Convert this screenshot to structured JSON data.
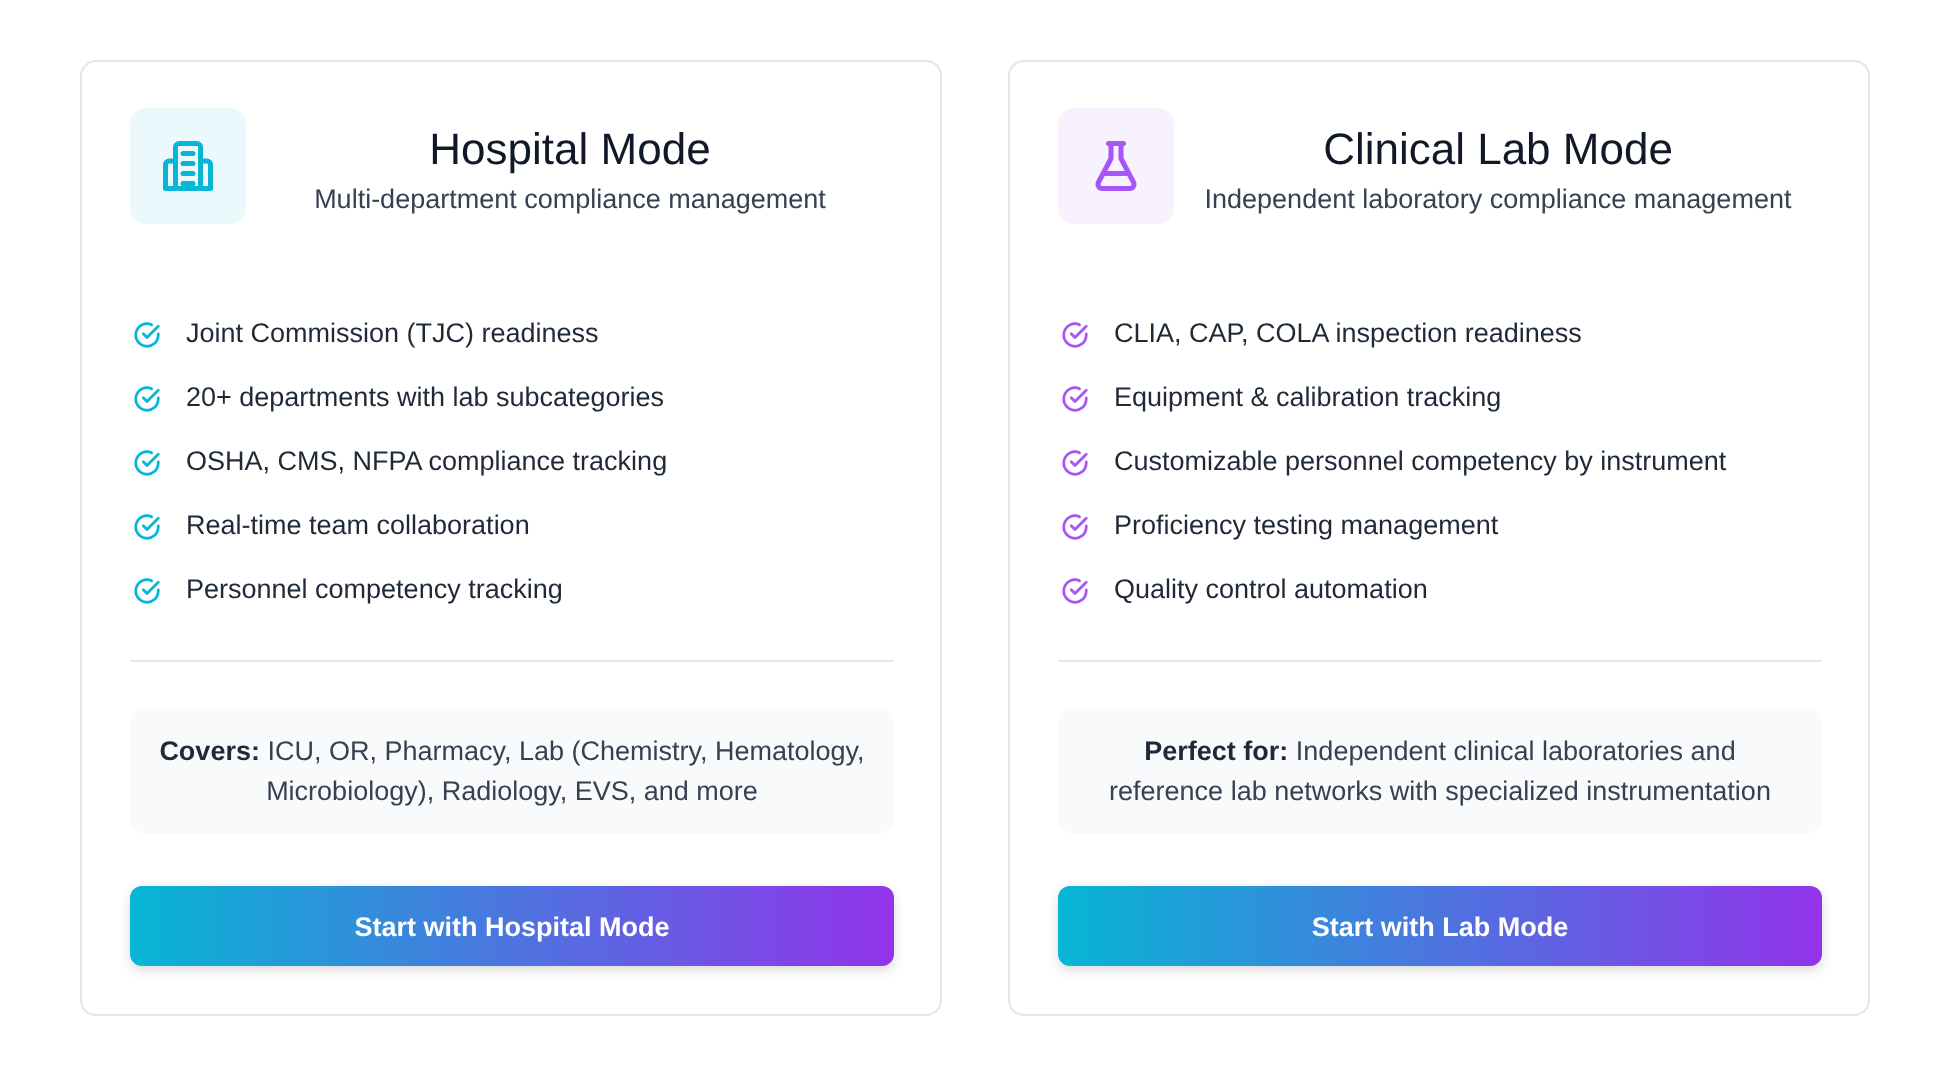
{
  "cards": [
    {
      "kind": "hospital",
      "color": "#06b6d4",
      "title": "Hospital Mode",
      "subtitle": "Multi-department compliance management",
      "features": [
        "Joint Commission (TJC) readiness",
        "20+ departments with lab subcategories",
        "OSHA, CMS, NFPA compliance tracking",
        "Real-time team collaboration",
        "Personnel competency tracking"
      ],
      "note": "**Covers:** ICU, OR, Pharmacy, Lab (Chemistry, Hematology, Microbiology), Radiology, EVS, and more",
      "button": "Start with Hospital Mode"
    },
    {
      "kind": "lab",
      "color": "#a855f7",
      "title": "Clinical Lab Mode",
      "subtitle": "Independent laboratory compliance management",
      "features": [
        "CLIA, CAP, COLA inspection readiness",
        "Equipment & calibration tracking",
        "Customizable personnel competency by instrument",
        "Proficiency testing management",
        "Quality control automation"
      ],
      "note": "**Perfect for:** Independent clinical laboratories and reference lab networks with specialized instrumentation",
      "button": "Start with Lab Mode"
    }
  ]
}
